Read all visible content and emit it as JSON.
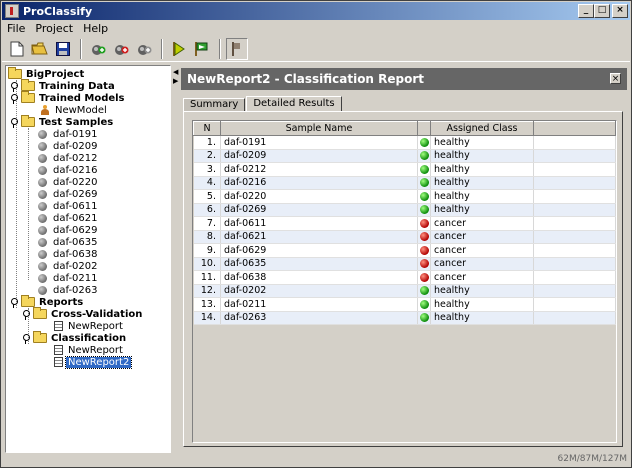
{
  "window": {
    "title": "ProClassify"
  },
  "menu": [
    "File",
    "Project",
    "Help"
  ],
  "toolbar": {
    "buttons": [
      {
        "name": "new-file-icon"
      },
      {
        "name": "open-folder-icon"
      },
      {
        "name": "save-icon"
      },
      {
        "name": "add-green-icon"
      },
      {
        "name": "add-red-icon"
      },
      {
        "name": "add-gray-icon"
      },
      {
        "name": "run-icon"
      },
      {
        "name": "run-report-icon"
      },
      {
        "name": "flag-icon"
      }
    ]
  },
  "tree": {
    "root": "BigProject",
    "training_data": "Training Data",
    "trained_models": "Trained Models",
    "model": "NewModel",
    "test_samples": "Test Samples",
    "samples": [
      "daf-0191",
      "daf-0209",
      "daf-0212",
      "daf-0216",
      "daf-0220",
      "daf-0269",
      "daf-0611",
      "daf-0621",
      "daf-0629",
      "daf-0635",
      "daf-0638",
      "daf-0202",
      "daf-0211",
      "daf-0263"
    ],
    "reports": "Reports",
    "cross_validation": "Cross-Validation",
    "cv_report": "NewReport",
    "classification": "Classification",
    "cl_report1": "NewReport",
    "cl_report2": "NewReport2"
  },
  "report": {
    "title": "NewReport2 - Classification Report",
    "tabs": [
      "Summary",
      "Detailed Results"
    ],
    "active_tab": "Detailed Results",
    "columns": [
      "N",
      "Sample Name",
      "",
      "Assigned Class",
      ""
    ],
    "rows": [
      {
        "n": "1.",
        "name": "daf-0191",
        "status": "green",
        "cls": "healthy"
      },
      {
        "n": "2.",
        "name": "daf-0209",
        "status": "green",
        "cls": "healthy"
      },
      {
        "n": "3.",
        "name": "daf-0212",
        "status": "green",
        "cls": "healthy"
      },
      {
        "n": "4.",
        "name": "daf-0216",
        "status": "green",
        "cls": "healthy"
      },
      {
        "n": "5.",
        "name": "daf-0220",
        "status": "green",
        "cls": "healthy"
      },
      {
        "n": "6.",
        "name": "daf-0269",
        "status": "green",
        "cls": "healthy"
      },
      {
        "n": "7.",
        "name": "daf-0611",
        "status": "red",
        "cls": "cancer"
      },
      {
        "n": "8.",
        "name": "daf-0621",
        "status": "red",
        "cls": "cancer"
      },
      {
        "n": "9.",
        "name": "daf-0629",
        "status": "red",
        "cls": "cancer"
      },
      {
        "n": "10.",
        "name": "daf-0635",
        "status": "red",
        "cls": "cancer"
      },
      {
        "n": "11.",
        "name": "daf-0638",
        "status": "red",
        "cls": "cancer"
      },
      {
        "n": "12.",
        "name": "daf-0202",
        "status": "green",
        "cls": "healthy"
      },
      {
        "n": "13.",
        "name": "daf-0211",
        "status": "green",
        "cls": "healthy"
      },
      {
        "n": "14.",
        "name": "daf-0263",
        "status": "green",
        "cls": "healthy"
      }
    ]
  },
  "status": {
    "memory": "62M/87M/127M"
  }
}
